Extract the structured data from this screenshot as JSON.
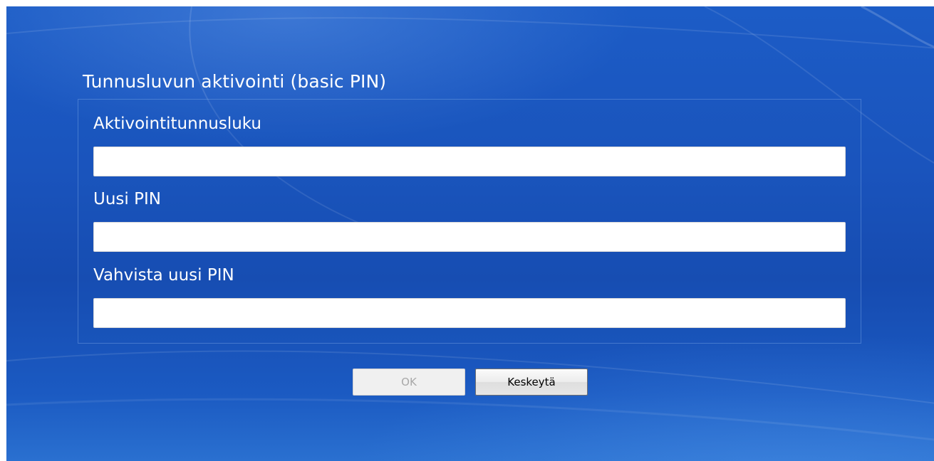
{
  "dialog": {
    "title": "Tunnusluvun aktivointi (basic PIN)"
  },
  "fields": {
    "activation_pin": {
      "label": "Aktivointitunnusluku",
      "value": ""
    },
    "new_pin": {
      "label": "Uusi PIN",
      "value": ""
    },
    "confirm_pin": {
      "label": "Vahvista uusi PIN",
      "value": ""
    }
  },
  "buttons": {
    "ok_label": "OK",
    "ok_enabled": false,
    "cancel_label": "Keskeytä"
  },
  "colors": {
    "background_blue": "#1a54bd",
    "text": "#ffffff",
    "disabled_text": "#a8a8a8"
  }
}
